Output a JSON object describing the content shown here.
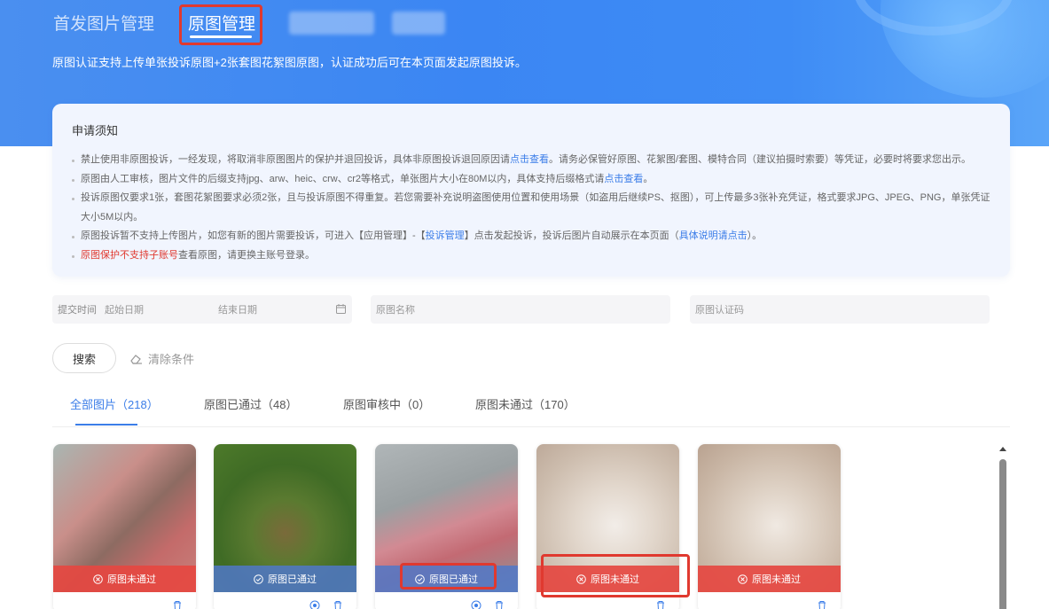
{
  "top_tabs": [
    "首发图片管理",
    "原图管理"
  ],
  "subtitle": "原图认证支持上传单张投诉原图+2张套图花絮图原图，认证成功后可在本页面发起原图投诉。",
  "notice": {
    "title": "申请须知",
    "item1_a": "禁止使用非原图投诉，一经发现，将取消非原图图片的保护并退回投诉，具体非原图投诉退回原因请",
    "item1_link": "点击查看",
    "item1_b": "。请务必保管好原图、花絮图/套图、模特合同（建议拍摄时索要）等凭证，必要时将要求您出示。",
    "item2_a": "原图由人工审核，图片文件的后缀支持jpg、arw、heic、crw、cr2等格式，单张图片大小在80M以内，具体支持后缀格式请",
    "item2_link": "点击查看",
    "item2_b": "。",
    "item3": "投诉原图仅要求1张，套图花絮图要求必须2张，且与投诉原图不得重复。若您需要补充说明盗图使用位置和使用场景（如盗用后继续PS、抠图），可上传最多3张补充凭证，格式要求JPG、JPEG、PNG，单张凭证大小5M以内。",
    "item4_a": "原图投诉暂不支持上传图片，如您有新的图片需要投诉，可进入【应用管理】-【",
    "item4_link1": "投诉管理",
    "item4_b": "】点击发起投诉，投诉后图片自动展示在本页面（",
    "item4_link2": "具体说明请点击",
    "item4_c": "）。",
    "item5_red": "原图保护不支持子账号",
    "item5_b": "查看原图，请更换主账号登录。"
  },
  "filters": {
    "submit_label": "提交时间",
    "start_placeholder": "起始日期",
    "end_placeholder": "结束日期",
    "name_placeholder": "原图名称",
    "code_placeholder": "原图认证码"
  },
  "buttons": {
    "search": "搜索",
    "clear": "清除条件"
  },
  "filter_tabs": [
    "全部图片（218）",
    "原图已通过（48）",
    "原图审核中（0）",
    "原图未通过（170）"
  ],
  "cards": [
    {
      "status": "原图未通过",
      "type": "fail"
    },
    {
      "status": "原图已通过",
      "type": "pass"
    },
    {
      "status": "原图已通过",
      "type": "pass"
    },
    {
      "status": "原图未通过",
      "type": "fail"
    },
    {
      "status": "原图未通过",
      "type": "fail"
    }
  ],
  "colors": {
    "brand_blue": "#3b7de8",
    "fail_red": "#e54841",
    "highlight": "#e0392f"
  }
}
